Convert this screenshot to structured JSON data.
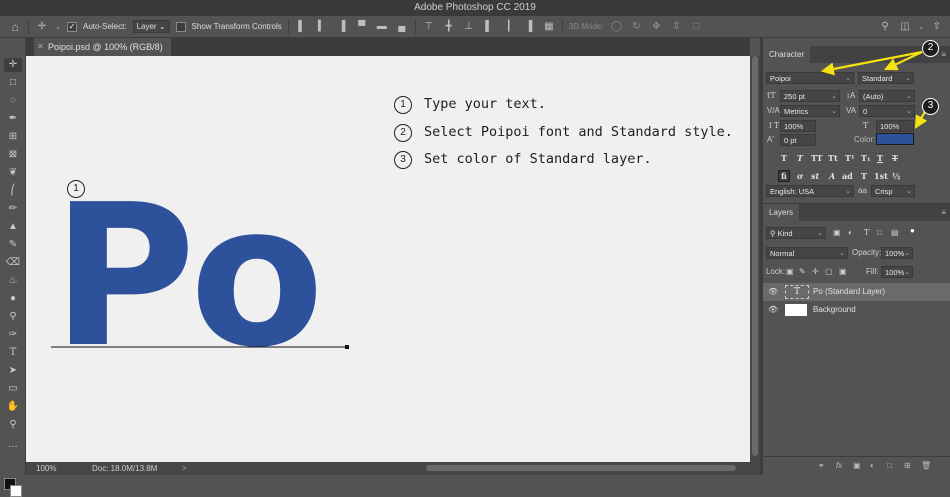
{
  "app": {
    "title": "Adobe Photoshop CC 2019"
  },
  "options_bar": {
    "auto_select_label": "Auto-Select:",
    "auto_select_value": "Layer",
    "show_transform_label": "Show Transform Controls",
    "mode_3d_label": "3D Mode:"
  },
  "document": {
    "tab_title": "Poipoi.psd @ 100% (RGB/8)",
    "text_content": "Po",
    "text_color": "#2e519b",
    "marker_label": "1"
  },
  "instructions": [
    {
      "num": "1",
      "text": "Type your text."
    },
    {
      "num": "2",
      "text": "Select Poipoi font and Standard style."
    },
    {
      "num": "3",
      "text": "Set color of Standard layer."
    }
  ],
  "callouts": {
    "font_marker": "2",
    "color_marker": "3",
    "arrow_color": "#f5e211"
  },
  "status": {
    "zoom": "100%",
    "doc_size": "Doc: 18.0M/13.8M",
    "arrow": ">"
  },
  "character_panel": {
    "tab": "Character",
    "font_family": "Poipoi",
    "font_style": "Standard",
    "font_size": "250 pt",
    "leading": "(Auto)",
    "kerning": "Metrics",
    "tracking": "0",
    "vertical_scale": "100%",
    "horizontal_scale": "100%",
    "baseline_shift": "0 pt",
    "color_label": "Color:",
    "color_value": "#2e519b",
    "format_buttons": [
      "T",
      "T",
      "TT",
      "Tt",
      "T¹",
      "T₁",
      "T",
      "T"
    ],
    "opentype_buttons": [
      "fi",
      "ơ",
      "st",
      "A",
      "ad",
      "T",
      "1st",
      "½"
    ],
    "language": "English: USA",
    "aa_label": "aa",
    "antialias": "Crisp"
  },
  "layers_panel": {
    "tab": "Layers",
    "filter_kind": "Kind",
    "blend_mode": "Normal",
    "opacity_label": "Opacity:",
    "opacity_value": "100%",
    "lock_label": "Lock:",
    "fill_label": "Fill:",
    "fill_value": "100%",
    "layers": [
      {
        "name": "Po (Standard Layer)",
        "type": "text",
        "selected": true
      },
      {
        "name": "Background",
        "type": "pixel",
        "selected": false
      }
    ],
    "text_layer_thumb": "T"
  }
}
